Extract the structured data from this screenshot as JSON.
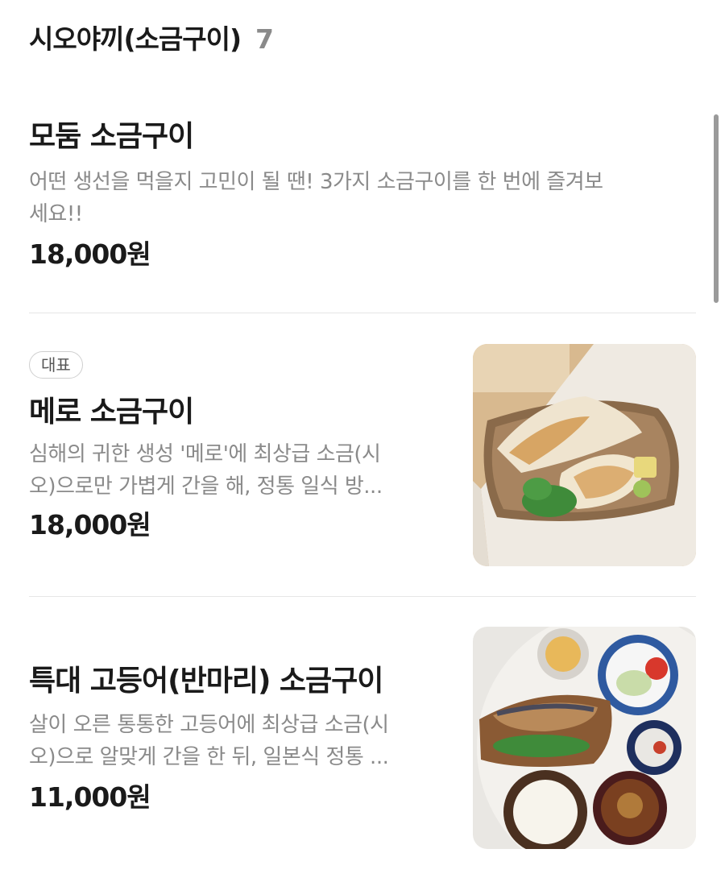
{
  "section": {
    "title": "시오야끼(소금구이)",
    "count": "7"
  },
  "items": [
    {
      "name": "모둠 소금구이",
      "desc_line1": "어떤 생선을 먹을지 고민이 될 땐! 3가지 소금구이를 한 번에 즐겨보",
      "desc_line2": "세요!!",
      "price": "18,000원"
    },
    {
      "badge": "대표",
      "name": "메로 소금구이",
      "desc_line1": "심해의 귀한 생성 '메로'에 최상급 소금(시",
      "desc_line2": "오)으로만 가볍게 간을 해, 정통 일식 방...",
      "price": "18,000원",
      "image_icon": "grilled-fish-photo"
    },
    {
      "name": "특대 고등어(반마리) 소금구이",
      "desc_line1": "살이 오른 통통한 고등어에 최상급 소금(시",
      "desc_line2": "오)으로 알맞게 간을 한 뒤, 일본식 정통 ...",
      "price": "11,000원",
      "image_icon": "mackerel-set-photo"
    }
  ],
  "colors": {
    "text": "#1a1a1a",
    "muted": "#8a8a8a",
    "divider": "#e6e6e6"
  }
}
